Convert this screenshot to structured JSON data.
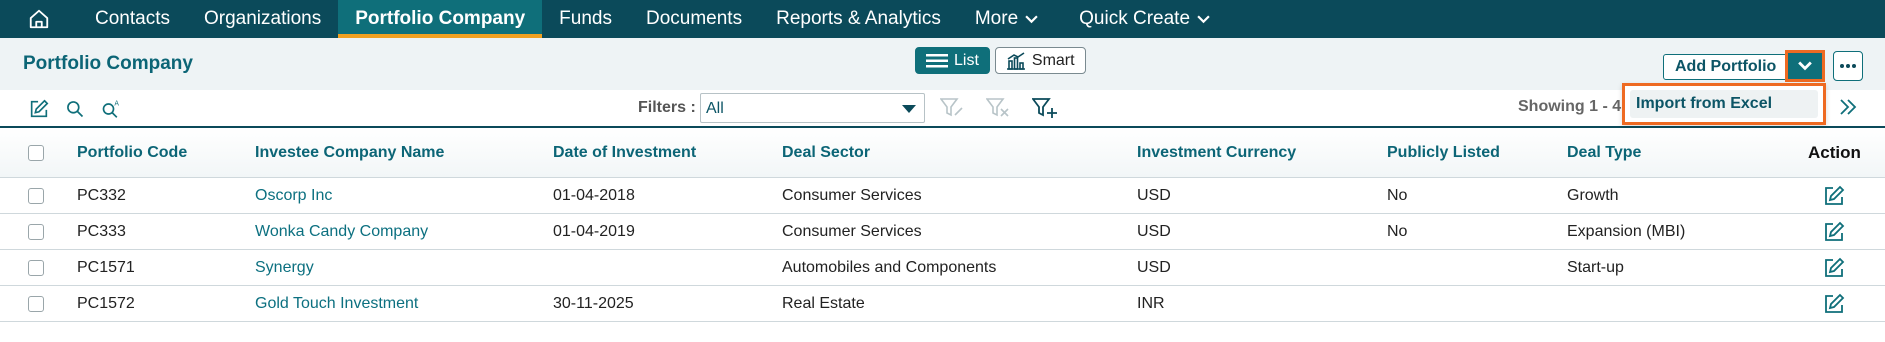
{
  "nav": {
    "items": [
      {
        "label": "Contacts",
        "active": false,
        "chevron": false
      },
      {
        "label": "Organizations",
        "active": false,
        "chevron": false
      },
      {
        "label": "Portfolio Company",
        "active": true,
        "chevron": false
      },
      {
        "label": "Funds",
        "active": false,
        "chevron": false
      },
      {
        "label": "Documents",
        "active": false,
        "chevron": false
      },
      {
        "label": "Reports & Analytics",
        "active": false,
        "chevron": false
      },
      {
        "label": "More",
        "active": false,
        "chevron": true
      },
      {
        "label": "Quick Create",
        "active": false,
        "chevron": true
      }
    ]
  },
  "header": {
    "title": "Portfolio Company",
    "view_list": "List",
    "view_smart": "Smart",
    "add_label": "Add Portfolio"
  },
  "toolbar": {
    "filters_label": "Filters :",
    "filter_value": "All",
    "showing": "Showing 1 - 4"
  },
  "dropdown": {
    "item": "Import from Excel"
  },
  "table": {
    "columns": [
      "Portfolio Code",
      "Investee Company Name",
      "Date of Investment",
      "Deal Sector",
      "Investment Currency",
      "Publicly Listed",
      "Deal Type",
      "Action"
    ],
    "rows": [
      {
        "code": "PC332",
        "company": "Oscorp Inc",
        "date": "01-04-2018",
        "sector": "Consumer Services",
        "currency": "USD",
        "listed": "No",
        "type": "Growth"
      },
      {
        "code": "PC333",
        "company": "Wonka Candy Company",
        "date": "01-04-2019",
        "sector": "Consumer Services",
        "currency": "USD",
        "listed": "No",
        "type": "Expansion (MBI)"
      },
      {
        "code": "PC1571",
        "company": "Synergy",
        "date": "",
        "sector": "Automobiles and Components",
        "currency": "USD",
        "listed": "",
        "type": "Start-up"
      },
      {
        "code": "PC1572",
        "company": "Gold Touch Investment",
        "date": "30-11-2025",
        "sector": "Real Estate",
        "currency": "INR",
        "listed": "",
        "type": ""
      }
    ]
  },
  "colors": {
    "nav_bg": "#0b4a5a",
    "accent": "#0f6f7a",
    "active_underline": "#f0a020",
    "highlight": "#ee6a22"
  }
}
